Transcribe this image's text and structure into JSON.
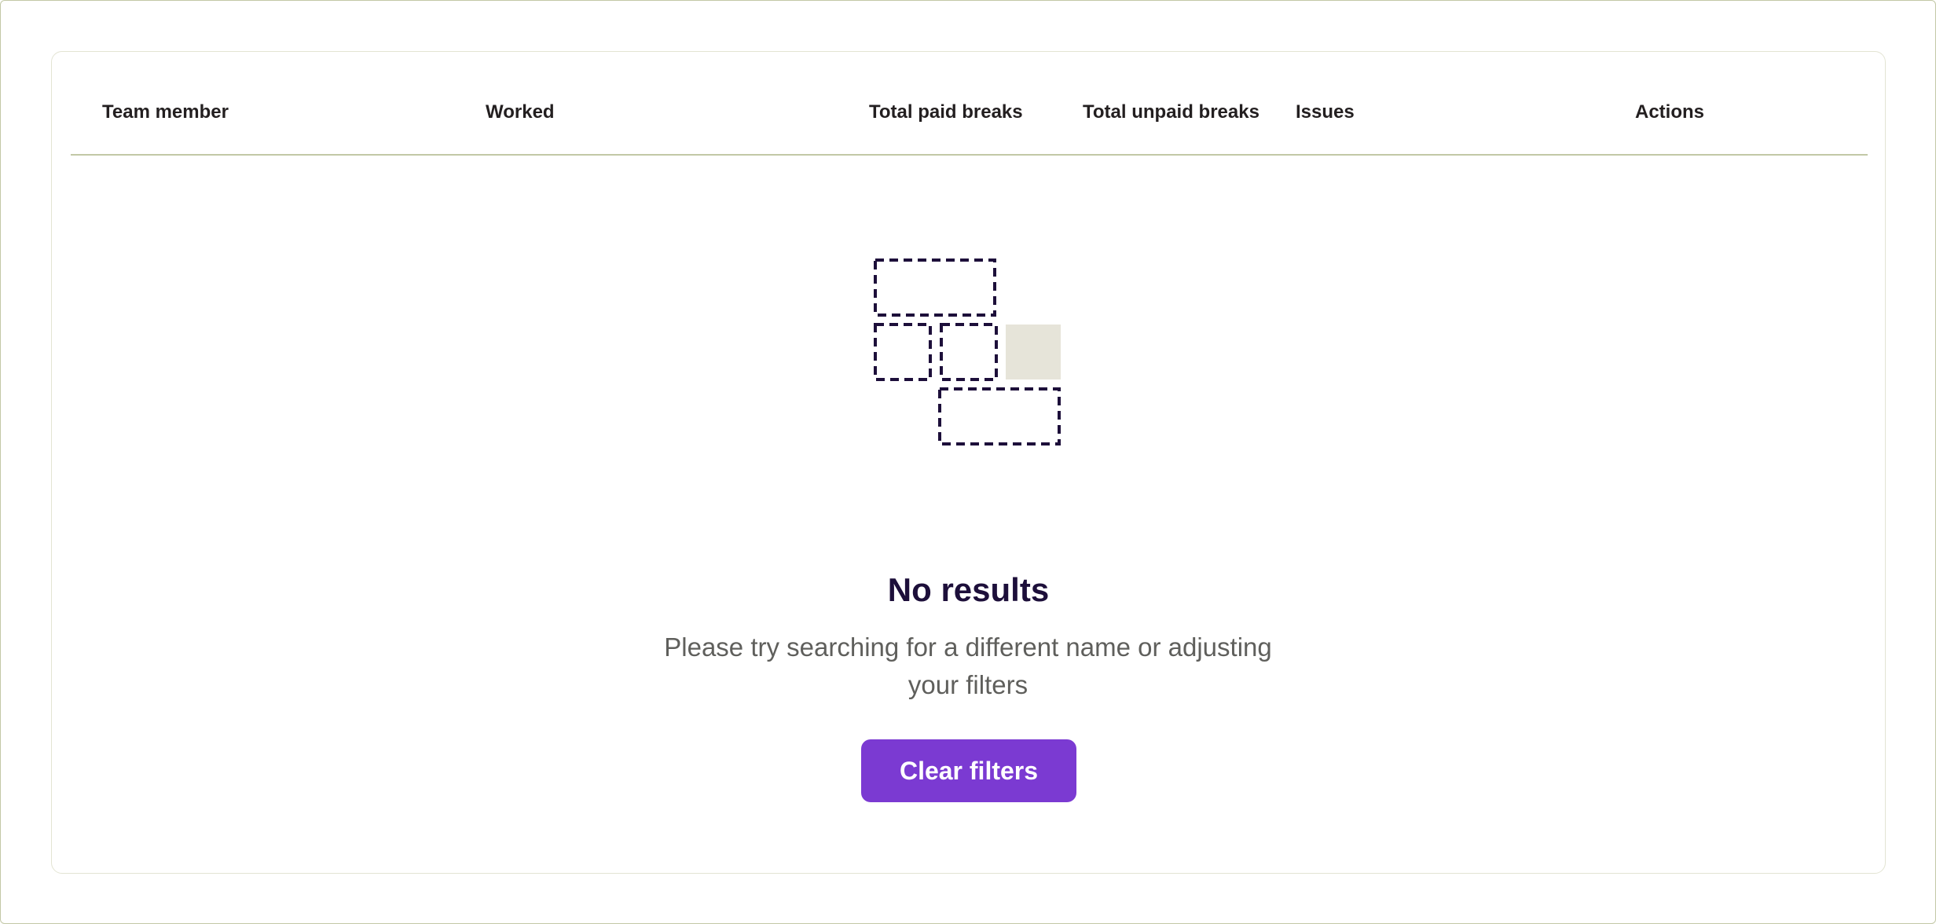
{
  "table": {
    "columns": [
      "Team member",
      "Worked",
      "Total paid breaks",
      "Total unpaid breaks",
      "Issues",
      "Actions"
    ]
  },
  "empty_state": {
    "icon": "empty-grid-illustration",
    "title": "No results",
    "description": "Please try searching for a different name or adjusting your filters",
    "button_label": "Clear filters"
  },
  "colors": {
    "accent": "#7b3ad2",
    "title": "#1d0f3a",
    "border": "#c2c8a6",
    "placeholder_fill": "#e6e4d9",
    "dash_stroke": "#1d0f3a"
  }
}
